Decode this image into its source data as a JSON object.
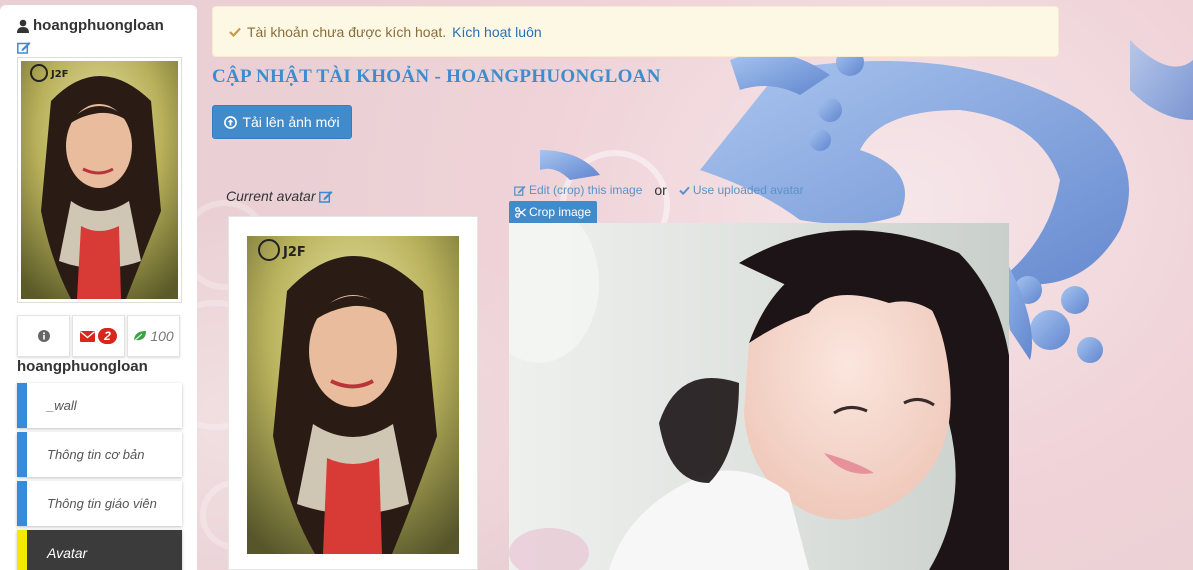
{
  "sidebar": {
    "username": "hoangphuongloan",
    "display_name": "hoangphuongloan",
    "stats": {
      "messages_count": "2",
      "points": "100"
    },
    "menu": [
      {
        "label": "_wall"
      },
      {
        "label": "Thông tin cơ bản"
      },
      {
        "label": "Thông tin giáo viên"
      },
      {
        "label": "Avatar",
        "active": true
      }
    ]
  },
  "alert": {
    "message": "Tài khoản chưa được kích hoạt.",
    "link_text": "Kích hoạt luôn"
  },
  "page": {
    "title": "CẬP NHẬT TÀI KHOẢN - HOANGPHUONGLOAN",
    "upload_button": "Tải lên ảnh mới",
    "current_avatar_label": "Current avatar",
    "edit_crop_link": "Edit (crop) this image",
    "or_text": "or",
    "use_uploaded_link": "Use uploaded avatar",
    "crop_button": "Crop image"
  },
  "colors": {
    "accent": "#428bca",
    "menu_border": "#3a8bd6",
    "active_menu_bg": "#3b3b3b",
    "active_menu_marker": "#f5e900",
    "badge": "#d9261c",
    "title": "#3c8dce"
  },
  "icons": {
    "user": "user-icon",
    "edit": "edit-icon",
    "info": "info-icon",
    "envelope": "envelope-icon",
    "leaf": "leaf-icon",
    "check": "check-icon",
    "upload": "upload-icon",
    "scissors": "scissors-icon"
  }
}
